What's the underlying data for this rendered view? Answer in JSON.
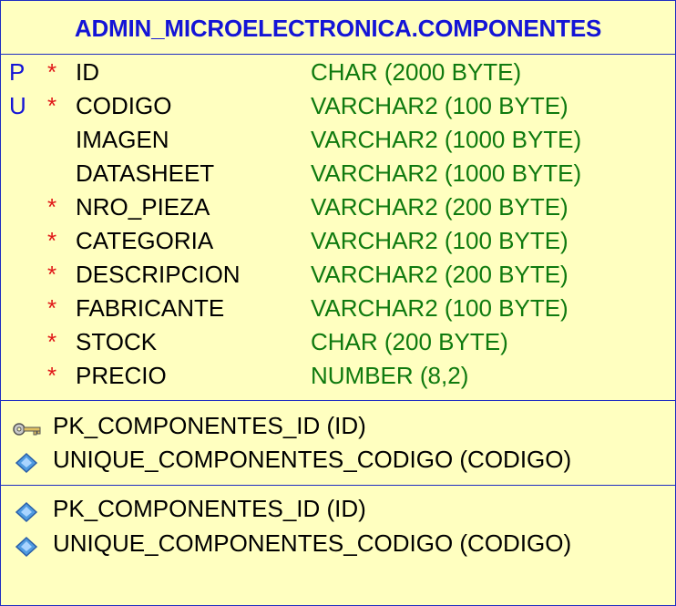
{
  "table": {
    "title": "ADMIN_MICROELECTRONICA.COMPONENTES",
    "columns": [
      {
        "key": "P",
        "required": "*",
        "name": "ID",
        "type": "CHAR (2000 BYTE)"
      },
      {
        "key": "U",
        "required": "*",
        "name": "CODIGO",
        "type": "VARCHAR2 (100 BYTE)"
      },
      {
        "key": "",
        "required": "",
        "name": "IMAGEN",
        "type": "VARCHAR2 (1000 BYTE)"
      },
      {
        "key": "",
        "required": "",
        "name": "DATASHEET",
        "type": "VARCHAR2 (1000 BYTE)"
      },
      {
        "key": "",
        "required": "*",
        "name": "NRO_PIEZA",
        "type": "VARCHAR2 (200 BYTE)"
      },
      {
        "key": "",
        "required": "*",
        "name": "CATEGORIA",
        "type": "VARCHAR2 (100 BYTE)"
      },
      {
        "key": "",
        "required": "*",
        "name": "DESCRIPCION",
        "type": "VARCHAR2 (200 BYTE)"
      },
      {
        "key": "",
        "required": "*",
        "name": "FABRICANTE",
        "type": "VARCHAR2 (100 BYTE)"
      },
      {
        "key": "",
        "required": "*",
        "name": "STOCK",
        "type": "CHAR (200 BYTE)"
      },
      {
        "key": "",
        "required": "*",
        "name": "PRECIO",
        "type": "NUMBER (8,2)"
      }
    ],
    "keys": [
      {
        "icon": "primary-key-icon",
        "label": "PK_COMPONENTES_ID (ID)"
      },
      {
        "icon": "unique-key-icon",
        "label": "UNIQUE_COMPONENTES_CODIGO (CODIGO)"
      }
    ],
    "indexes": [
      {
        "icon": "index-icon",
        "label": "PK_COMPONENTES_ID (ID)"
      },
      {
        "icon": "index-icon",
        "label": "UNIQUE_COMPONENTES_CODIGO (CODIGO)"
      }
    ]
  },
  "colors": {
    "background": "#ffffc0",
    "border": "#1f2ec2",
    "title": "#1414d6",
    "key_flag": "#1414d6",
    "required": "#e01818",
    "type": "#0f7a0f",
    "text": "#000000"
  }
}
